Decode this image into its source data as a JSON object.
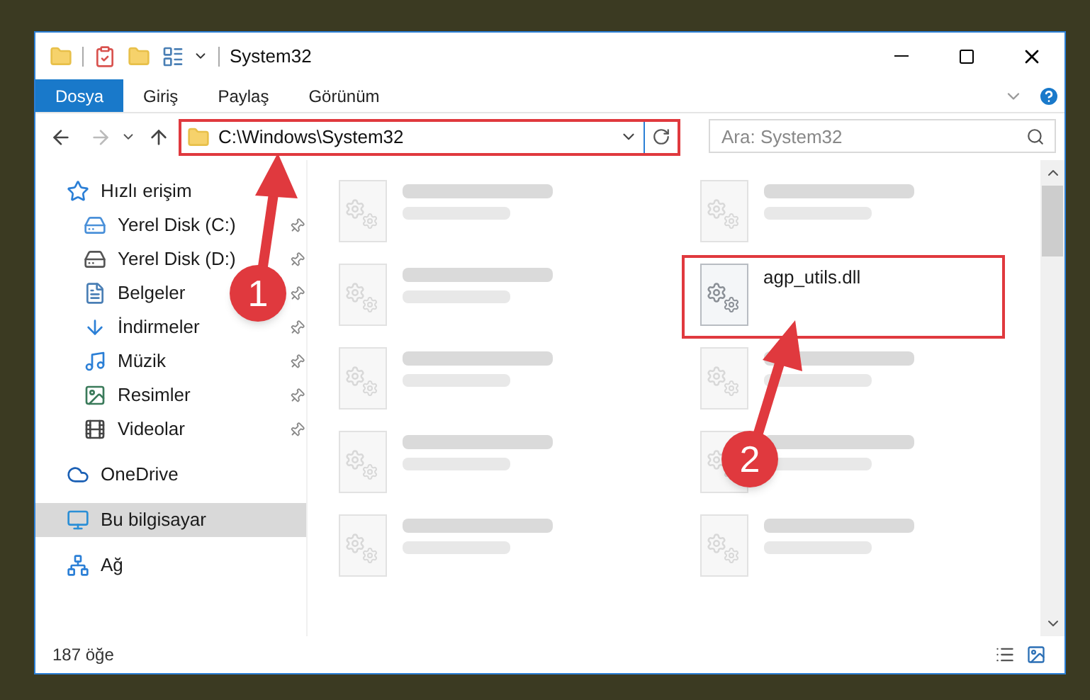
{
  "window": {
    "title": "System32"
  },
  "ribbon_tabs": [
    {
      "label": "Dosya",
      "selected": true
    },
    {
      "label": "Giriş",
      "selected": false
    },
    {
      "label": "Paylaş",
      "selected": false
    },
    {
      "label": "Görünüm",
      "selected": false
    }
  ],
  "address_bar": {
    "path": "C:\\Windows\\System32"
  },
  "search": {
    "placeholder": "Ara: System32"
  },
  "navigation": [
    {
      "label": "Hızlı erişim",
      "selected": false,
      "children": [
        {
          "label": "Yerel Disk (C:)",
          "pinned": true
        },
        {
          "label": "Yerel Disk (D:)",
          "pinned": true
        },
        {
          "label": "Belgeler",
          "pinned": true
        },
        {
          "label": "İndirmeler",
          "pinned": true
        },
        {
          "label": "Müzik",
          "pinned": true
        },
        {
          "label": "Resimler",
          "pinned": true
        },
        {
          "label": "Videolar",
          "pinned": true
        }
      ]
    },
    {
      "label": "OneDrive",
      "selected": false
    },
    {
      "label": "Bu bilgisayar",
      "selected": true
    },
    {
      "label": "Ağ",
      "selected": false
    }
  ],
  "files": [
    {
      "blurred": true
    },
    {
      "blurred": true
    },
    {
      "blurred": true
    },
    {
      "name": "agp_utils.dll",
      "blurred": false
    },
    {
      "blurred": true
    },
    {
      "blurred": true
    },
    {
      "blurred": true
    },
    {
      "blurred": true
    },
    {
      "blurred": true
    },
    {
      "blurred": true
    }
  ],
  "status_bar": {
    "item_count": "187 öğe"
  },
  "annotations": [
    {
      "number": "1"
    },
    {
      "number": "2"
    }
  ]
}
